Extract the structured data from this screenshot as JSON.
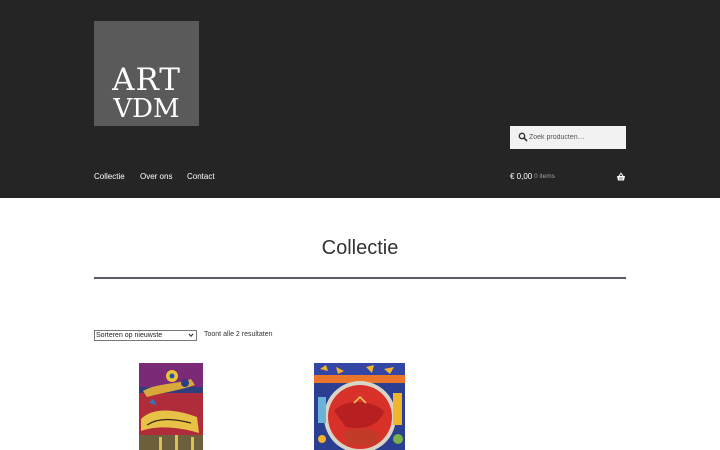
{
  "logo": {
    "line1": "ART",
    "line2": "VDM"
  },
  "search": {
    "placeholder": "Zoek producten…"
  },
  "nav": {
    "items": [
      "Collectie",
      "Over ons",
      "Contact"
    ]
  },
  "cart": {
    "price": "€ 0,00",
    "items": "0 items"
  },
  "page": {
    "title": "Collectie"
  },
  "shop": {
    "sort_selected": "Sorteren op nieuwste",
    "result_count": "Toont alle 2 resultaten"
  },
  "colors": {
    "header_bg": "#252525",
    "logo_bg": "#5a5a5a",
    "rule": "#5a5a6b"
  }
}
